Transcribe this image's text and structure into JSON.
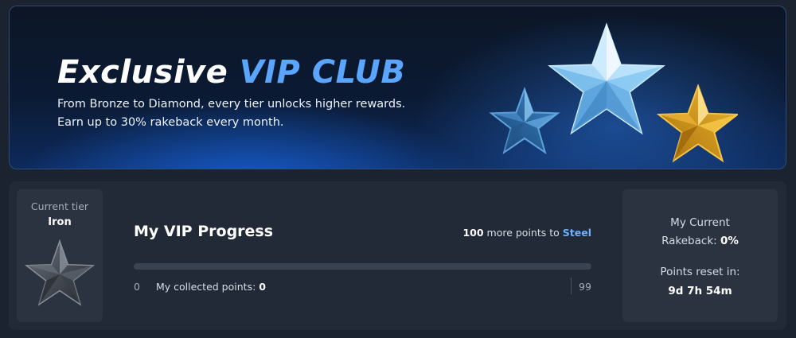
{
  "banner": {
    "title_part1": "Exclusive",
    "title_part2": "VIP CLUB",
    "line1": "From Bronze to Diamond, every tier unlocks higher rewards.",
    "line2": "Earn up to 30% rakeback every month."
  },
  "tier": {
    "caption": "Current tier",
    "name": "Iron"
  },
  "progress": {
    "title": "My VIP Progress",
    "points_needed": "100",
    "more_points_text": "more points to",
    "next_tier": "Steel",
    "min": "0",
    "max": "99",
    "collected_label": "My collected points:",
    "collected_value": "0",
    "fill_fraction": 0
  },
  "rakeback": {
    "line1": "My Current",
    "line2_label": "Rakeback:",
    "value": "0%",
    "reset_label": "Points reset in:",
    "reset_value": "9d 7h 54m"
  },
  "colors": {
    "accent_blue": "#5aa6ff",
    "steel_link": "#6eb0ff",
    "background": "#1b2230",
    "panel": "#222a37",
    "tile": "#2b3341"
  }
}
